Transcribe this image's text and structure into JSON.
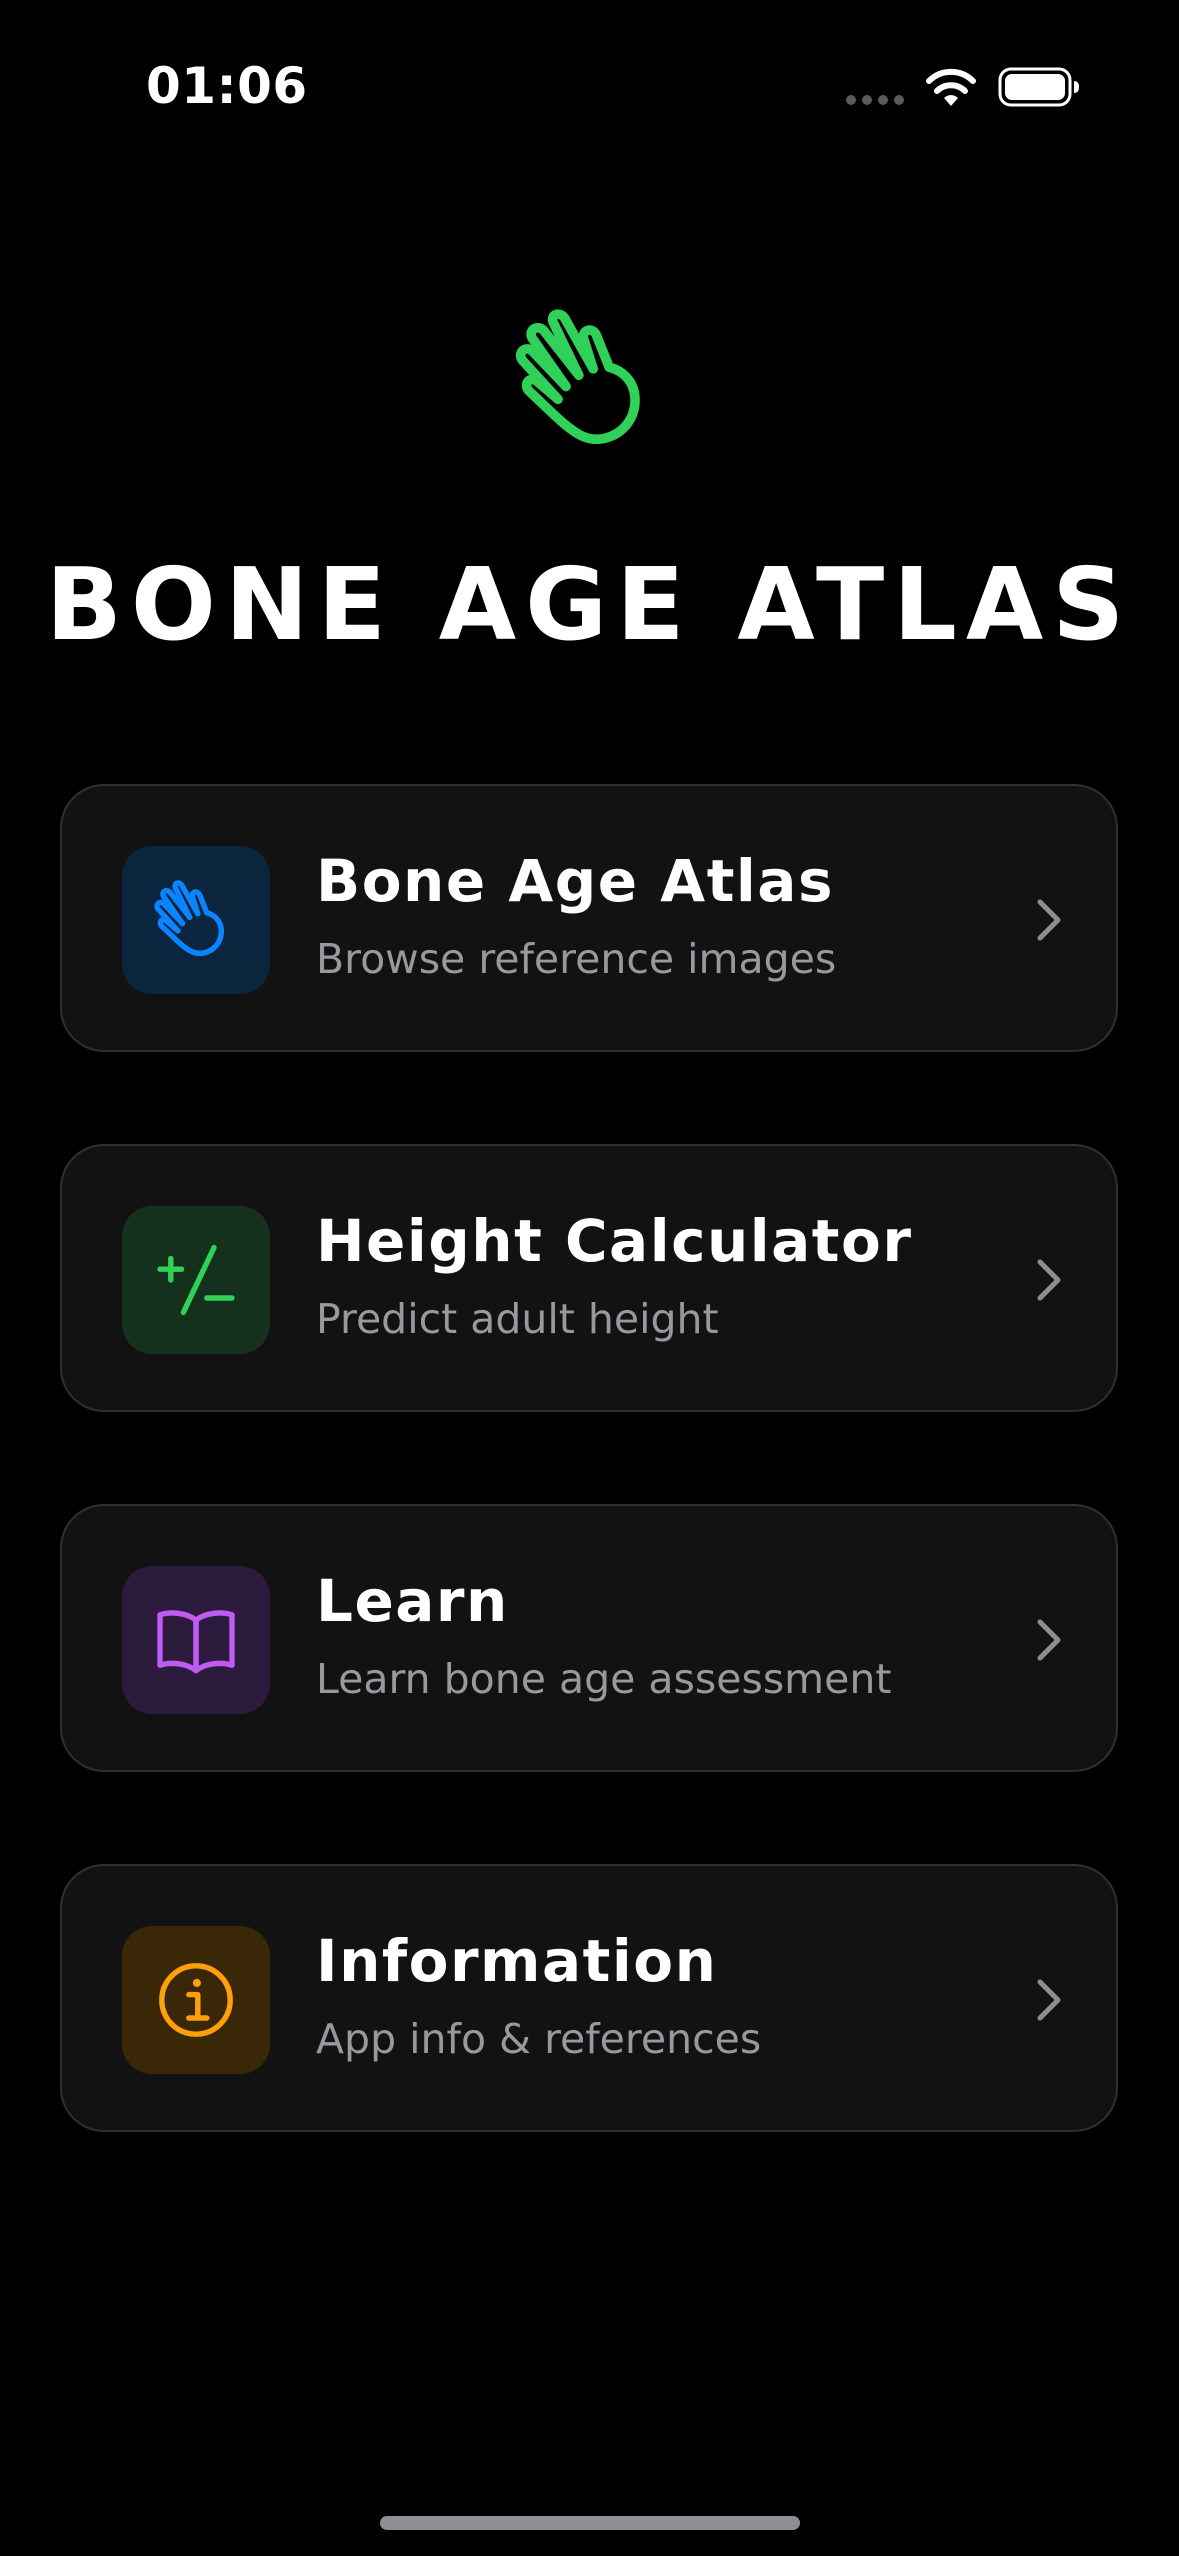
{
  "status_bar": {
    "time": "01:06",
    "signal_icon": "cellular-dots-icon",
    "wifi_icon": "wifi-icon",
    "battery_icon": "battery-full-icon"
  },
  "hero": {
    "icon": "waving-hand-icon",
    "icon_color": "#30d158",
    "title": "BONE AGE ATLAS"
  },
  "menu": {
    "items": [
      {
        "icon": "waving-hand-icon",
        "icon_color": "#0a84ff",
        "icon_bg": "#0d2640",
        "title": "Bone Age Atlas",
        "subtitle": "Browse reference images"
      },
      {
        "icon": "plus-slash-minus-icon",
        "icon_color": "#30d158",
        "icon_bg": "#15301d",
        "title": "Height Calculator",
        "subtitle": "Predict adult height"
      },
      {
        "icon": "book-icon",
        "icon_color": "#bf5af2",
        "icon_bg": "#2d1b3d",
        "title": "Learn",
        "subtitle": "Learn bone age assessment"
      },
      {
        "icon": "info-circle-icon",
        "icon_color": "#ff9f0a",
        "icon_bg": "#3a2708",
        "title": "Information",
        "subtitle": "App info & references"
      }
    ]
  },
  "colors": {
    "background": "#000000",
    "card_bg": "#121212",
    "card_border": "#2f2f31",
    "subtitle": "#98989e",
    "chevron": "#8e8e93"
  }
}
